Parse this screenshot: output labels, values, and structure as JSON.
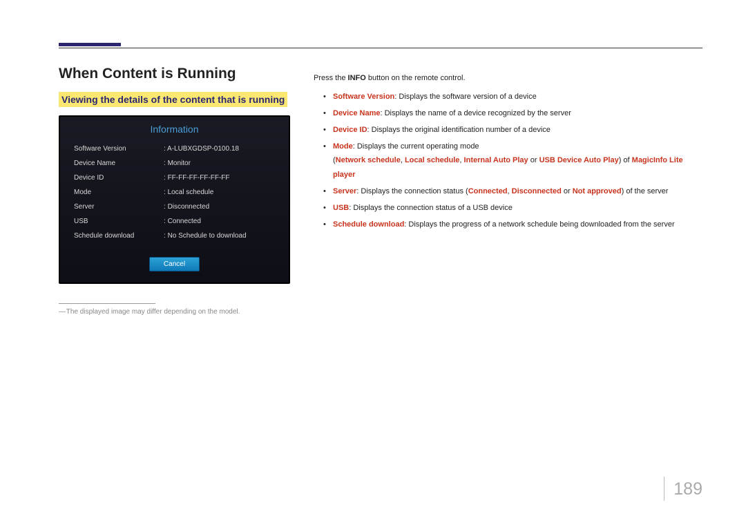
{
  "section_title": "When Content is Running",
  "subsection_title": "Viewing the details of the content that is running",
  "info_panel": {
    "title": "Information",
    "rows": [
      {
        "label": "Software Version",
        "value": "A-LUBXGDSP-0100.18"
      },
      {
        "label": "Device Name",
        "value": "Monitor"
      },
      {
        "label": "Device ID",
        "value": "FF-FF-FF-FF-FF-FF"
      },
      {
        "label": "Mode",
        "value": "Local schedule"
      },
      {
        "label": "Server",
        "value": "Disconnected"
      },
      {
        "label": "USB",
        "value": "Connected"
      },
      {
        "label": "Schedule download",
        "value": "No Schedule to download"
      }
    ],
    "cancel_label": "Cancel"
  },
  "footnote": "The displayed image may differ depending on the model.",
  "intro": {
    "pre": "Press the ",
    "btn": "INFO",
    "post": " button on the remote control."
  },
  "items": [
    {
      "term": "Software Version",
      "desc": ": Displays the software version of a device"
    },
    {
      "term": "Device Name",
      "desc": ": Displays the name of a device recognized by the server"
    },
    {
      "term": "Device ID",
      "desc": ": Displays the original identification number of a device"
    },
    {
      "term": "Mode",
      "desc": ": Displays the current operating mode"
    }
  ],
  "mode_sub": {
    "open": "(",
    "t1": "Network schedule",
    "s1": ", ",
    "t2": "Local schedule",
    "s2": ", ",
    "t3": "Internal Auto Play",
    "s3": " or ",
    "t4": "USB Device Auto Play",
    "close": ") of ",
    "t5": "MagicInfo Lite player"
  },
  "server_item": {
    "term": "Server",
    "pre": ": Displays the connection status (",
    "c1": "Connected",
    "s1": ", ",
    "c2": "Disconnected",
    "s2": " or ",
    "c3": "Not approved",
    "post": ") of the server"
  },
  "usb_item": {
    "term": "USB",
    "desc": ": Displays the connection status of a USB device"
  },
  "sched_item": {
    "term": "Schedule download",
    "desc": ": Displays the progress of a network schedule being downloaded from the server"
  },
  "page_number": "189"
}
